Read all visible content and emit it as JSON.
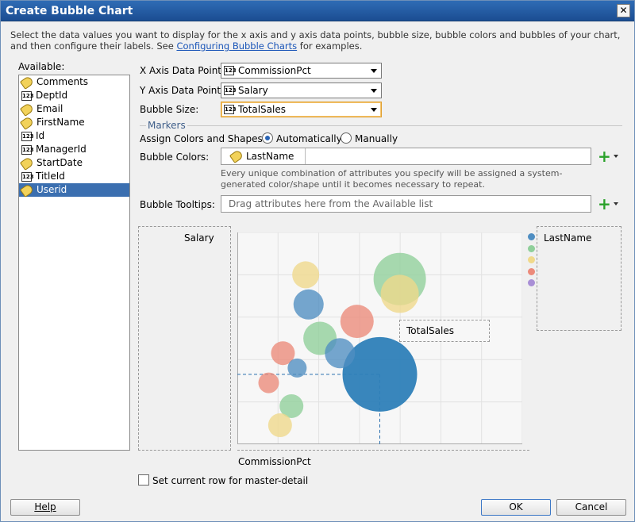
{
  "window": {
    "title": "Create Bubble Chart",
    "close_glyph": "✕"
  },
  "intro": {
    "text": "Select the data values you want to display for the x axis and y axis data points, bubble size, bubble colors and bubbles of your chart, and then configure their labels. See",
    "link": "Configuring Bubble Charts",
    "after": "for examples."
  },
  "available": {
    "label": "Available:",
    "items": [
      {
        "label": "Comments",
        "icon": "tag-icon"
      },
      {
        "label": "DeptId",
        "icon": "number-icon"
      },
      {
        "label": "Email",
        "icon": "tag-icon"
      },
      {
        "label": "FirstName",
        "icon": "tag-icon"
      },
      {
        "label": "Id",
        "icon": "number-icon"
      },
      {
        "label": "ManagerId",
        "icon": "number-icon"
      },
      {
        "label": "StartDate",
        "icon": "tag-icon"
      },
      {
        "label": "TitleId",
        "icon": "number-icon"
      },
      {
        "label": "Userid",
        "icon": "tag-icon",
        "selected": true
      }
    ]
  },
  "x_axis": {
    "label": "X Axis Data Point:",
    "value": "CommissionPct",
    "icon_text": "123"
  },
  "y_axis": {
    "label": "Y Axis Data Point:",
    "value": "Salary",
    "icon_text": "123"
  },
  "bubble_size": {
    "label": "Bubble Size:",
    "value": "TotalSales",
    "icon_text": "123"
  },
  "markers": {
    "title": "Markers",
    "assign_label": "Assign Colors and Shapes:",
    "auto_label": "Automatically",
    "manual_label": "Manually",
    "selected": "Automatically",
    "bubble_colors_label": "Bubble Colors:",
    "bubble_colors_value": "LastName",
    "hint": "Every unique combination of attributes you specify will be assigned a system-generated color/shape until it becomes necessary to repeat.",
    "tooltips_label": "Bubble Tooltips:",
    "tooltips_placeholder": "Drag attributes here from the Available list"
  },
  "preview": {
    "y_label": "Salary",
    "x_label": "CommissionPct",
    "size_label": "TotalSales",
    "legend_title": "LastName",
    "legend_colors": [
      "#4f8ec2",
      "#8fcf9a",
      "#f0d98a",
      "#ec8a7a",
      "#a98fd6"
    ]
  },
  "chart_data": {
    "type": "scatter",
    "title": "",
    "xlabel": "CommissionPct",
    "ylabel": "Salary",
    "grid": true,
    "legend": "right",
    "series": [
      {
        "color": "#4f8ec2",
        "points": [
          {
            "x": 0.25,
            "y": 0.66,
            "r": 19
          },
          {
            "x": 0.36,
            "y": 0.43,
            "r": 19
          },
          {
            "x": 0.21,
            "y": 0.36,
            "r": 12
          },
          {
            "x": 0.5,
            "y": 0.33,
            "r": 47
          }
        ]
      },
      {
        "color": "#8fcf9a",
        "points": [
          {
            "x": 0.57,
            "y": 0.78,
            "r": 33
          },
          {
            "x": 0.29,
            "y": 0.5,
            "r": 21
          },
          {
            "x": 0.19,
            "y": 0.18,
            "r": 15
          }
        ]
      },
      {
        "color": "#f0d98a",
        "points": [
          {
            "x": 0.24,
            "y": 0.8,
            "r": 17
          },
          {
            "x": 0.57,
            "y": 0.71,
            "r": 24
          },
          {
            "x": 0.15,
            "y": 0.09,
            "r": 15
          }
        ]
      },
      {
        "color": "#ec8a7a",
        "points": [
          {
            "x": 0.42,
            "y": 0.58,
            "r": 21
          },
          {
            "x": 0.16,
            "y": 0.43,
            "r": 15
          },
          {
            "x": 0.11,
            "y": 0.29,
            "r": 13
          }
        ]
      }
    ],
    "highlight_guides": {
      "x": 0.5,
      "y": 0.33
    }
  },
  "master_detail": {
    "label": "Set current row for master-detail"
  },
  "buttons": {
    "help": "Help",
    "ok": "OK",
    "cancel": "Cancel"
  }
}
